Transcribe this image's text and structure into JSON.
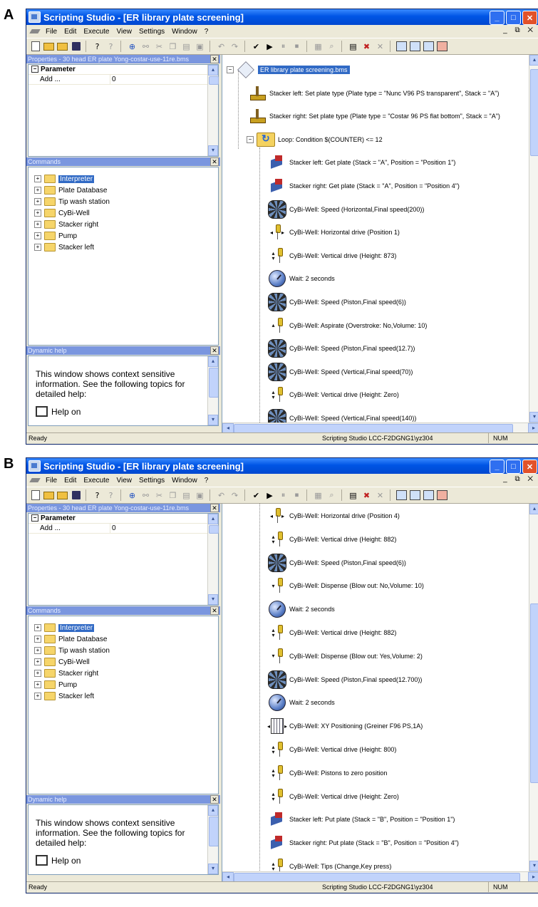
{
  "panels": [
    {
      "letter": "A",
      "window_title": "Scripting Studio - [ER library plate screening]",
      "menu": [
        "File",
        "Edit",
        "Execute",
        "View",
        "Settings",
        "Window",
        "?"
      ],
      "properties_pane": {
        "title": "Properties - 30 head ER plate Yong-costar-use-11re.bms",
        "header": "Parameter",
        "rows": [
          {
            "name": "Add ...",
            "value": "0"
          }
        ]
      },
      "commands_pane": {
        "title": "Commands",
        "items": [
          "Interpreter",
          "Plate Database",
          "Tip wash station",
          "CyBi-Well",
          "Stacker right",
          "Pump",
          "Stacker left"
        ],
        "selected": "Interpreter"
      },
      "help_pane": {
        "title": "Dynamic help",
        "text": "This window shows context sensitive information. See the following topics for detailed help:",
        "link": "Help on"
      },
      "script": [
        {
          "level": 0,
          "icon": "root-icon",
          "text": "ER library plate screening.bms",
          "selected": true
        },
        {
          "level": 1,
          "icon": "plate-type-icon",
          "text": "Stacker left: Set plate type (Plate type = \"Nunc V96 PS transparent\", Stack = \"A\")"
        },
        {
          "level": 1,
          "icon": "plate-type-icon",
          "text": "Stacker right: Set plate type (Plate type = \"Costar 96 PS flat bottom\", Stack = \"A\")"
        },
        {
          "level": 1,
          "icon": "loop-icon",
          "text": "Loop: Condition $(COUNTER) <= 12",
          "expander": "-"
        },
        {
          "level": 2,
          "icon": "stacker-icon",
          "text": "Stacker left: Get plate (Stack = \"A\", Position = \"Position 1\")"
        },
        {
          "level": 2,
          "icon": "stacker-icon",
          "text": "Stacker right: Get plate (Stack = \"A\", Position = \"Position 4\")"
        },
        {
          "level": 2,
          "icon": "gears-icon",
          "text": "CyBi-Well: Speed (Horizontal,Final speed(200))"
        },
        {
          "level": 2,
          "icon": "horizontal-drive-icon",
          "text": "CyBi-Well: Horizontal drive (Position 1)"
        },
        {
          "level": 2,
          "icon": "vertical-drive-icon",
          "text": "CyBi-Well: Vertical drive (Height: 873)"
        },
        {
          "level": 2,
          "icon": "clock-icon",
          "text": "Wait: 2 seconds"
        },
        {
          "level": 2,
          "icon": "gears-icon",
          "text": "CyBi-Well: Speed (Piston,Final speed(6))"
        },
        {
          "level": 2,
          "icon": "aspirate-icon",
          "text": "CyBi-Well: Aspirate (Overstroke: No,Volume: 10)"
        },
        {
          "level": 2,
          "icon": "gears-icon",
          "text": "CyBi-Well: Speed (Piston,Final speed(12.7))"
        },
        {
          "level": 2,
          "icon": "gears-icon",
          "text": "CyBi-Well: Speed (Vertical,Final speed(70))"
        },
        {
          "level": 2,
          "icon": "vertical-drive-icon",
          "text": "CyBi-Well: Vertical drive (Height: Zero)"
        },
        {
          "level": 2,
          "icon": "gears-icon",
          "text": "CyBi-Well: Speed (Vertical,Final speed(140))"
        }
      ],
      "status": {
        "left": "Ready",
        "middle": "Scripting Studio  LCC-F2DGNG1\\yz304",
        "right": "NUM"
      }
    },
    {
      "letter": "B",
      "window_title": "Scripting Studio - [ER library plate screening]",
      "menu": [
        "File",
        "Edit",
        "Execute",
        "View",
        "Settings",
        "Window",
        "?"
      ],
      "properties_pane": {
        "title": "Properties - 30 head ER plate Yong-costar-use-11re.bms",
        "header": "Parameter",
        "rows": [
          {
            "name": "Add ...",
            "value": "0"
          }
        ]
      },
      "commands_pane": {
        "title": "Commands",
        "items": [
          "Interpreter",
          "Plate Database",
          "Tip wash station",
          "CyBi-Well",
          "Stacker right",
          "Pump",
          "Stacker left"
        ],
        "selected": "Interpreter"
      },
      "help_pane": {
        "title": "Dynamic help",
        "text": "This window shows context sensitive information. See the following topics for detailed help:",
        "link": "Help on"
      },
      "script": [
        {
          "level": 2,
          "icon": "horizontal-drive-icon",
          "text": "CyBi-Well: Horizontal drive (Position 4)"
        },
        {
          "level": 2,
          "icon": "vertical-drive-icon",
          "text": "CyBi-Well: Vertical drive (Height: 882)"
        },
        {
          "level": 2,
          "icon": "gears-icon",
          "text": "CyBi-Well: Speed (Piston,Final speed(6))"
        },
        {
          "level": 2,
          "icon": "dispense-icon",
          "text": "CyBi-Well: Dispense (Blow out: No,Volume: 10)"
        },
        {
          "level": 2,
          "icon": "clock-icon",
          "text": "Wait: 2 seconds"
        },
        {
          "level": 2,
          "icon": "vertical-drive-icon",
          "text": "CyBi-Well: Vertical drive (Height: 882)"
        },
        {
          "level": 2,
          "icon": "dispense-icon",
          "text": "CyBi-Well: Dispense (Blow out: Yes,Volume: 2)"
        },
        {
          "level": 2,
          "icon": "gears-icon",
          "text": "CyBi-Well: Speed (Piston,Final speed(12.700))"
        },
        {
          "level": 2,
          "icon": "clock-icon",
          "text": "Wait: 2 seconds"
        },
        {
          "level": 2,
          "icon": "xy-positioning-icon",
          "text": "CyBi-Well: XY Positioning (Greiner F96 PS,1A)"
        },
        {
          "level": 2,
          "icon": "vertical-drive-icon",
          "text": "CyBi-Well: Vertical drive (Height: 800)"
        },
        {
          "level": 2,
          "icon": "pistons-zero-icon",
          "text": "CyBi-Well: Pistons to zero position"
        },
        {
          "level": 2,
          "icon": "vertical-drive-icon",
          "text": "CyBi-Well: Vertical drive (Height: Zero)"
        },
        {
          "level": 2,
          "icon": "stacker-icon",
          "text": "Stacker left: Put plate (Stack = \"B\", Position = \"Position 1\")"
        },
        {
          "level": 2,
          "icon": "stacker-icon",
          "text": "Stacker right: Put plate (Stack = \"B\", Position = \"Position 4\")"
        },
        {
          "level": 2,
          "icon": "tips-icon",
          "text": "CyBi-Well: Tips (Change,Key press)"
        }
      ],
      "status": {
        "left": "Ready",
        "middle": "Scripting Studio  LCC-F2DGNG1\\yz304",
        "right": "NUM"
      }
    }
  ]
}
